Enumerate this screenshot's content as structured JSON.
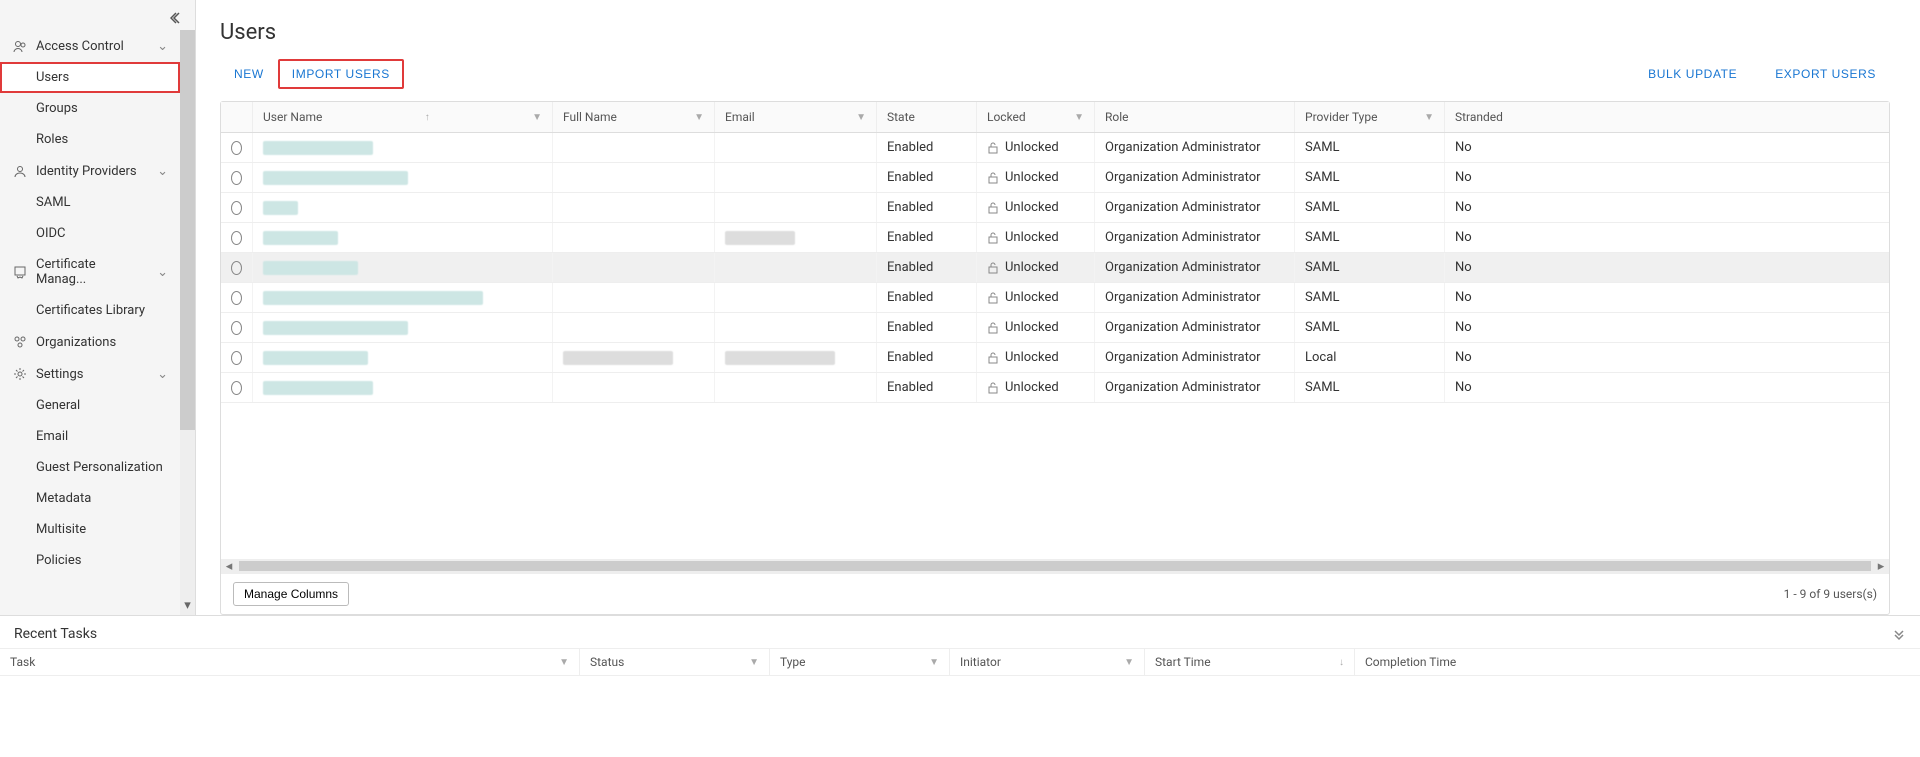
{
  "page": {
    "title": "Users"
  },
  "sidebar": {
    "groups": {
      "access_control": {
        "label": "Access Control"
      },
      "identity_providers": {
        "label": "Identity Providers"
      },
      "certificate_mgmt": {
        "label": "Certificate Manag..."
      },
      "organizations": {
        "label": "Organizations"
      },
      "settings": {
        "label": "Settings"
      }
    },
    "items": {
      "users": "Users",
      "groups": "Groups",
      "roles": "Roles",
      "saml": "SAML",
      "oidc": "OIDC",
      "cert_library": "Certificates Library",
      "general": "General",
      "email": "Email",
      "guest_personalization": "Guest Personalization",
      "metadata": "Metadata",
      "multisite": "Multisite",
      "policies": "Policies"
    }
  },
  "toolbar": {
    "new": "NEW",
    "import": "IMPORT USERS",
    "bulk_update": "BULK UPDATE",
    "export": "EXPORT USERS"
  },
  "grid": {
    "columns": {
      "user_name": "User Name",
      "full_name": "Full Name",
      "email": "Email",
      "state": "State",
      "locked": "Locked",
      "role": "Role",
      "provider_type": "Provider Type",
      "stranded": "Stranded"
    },
    "rows": [
      {
        "state": "Enabled",
        "locked": "Unlocked",
        "role": "Organization Administrator",
        "provider": "SAML",
        "stranded": "No"
      },
      {
        "state": "Enabled",
        "locked": "Unlocked",
        "role": "Organization Administrator",
        "provider": "SAML",
        "stranded": "No"
      },
      {
        "state": "Enabled",
        "locked": "Unlocked",
        "role": "Organization Administrator",
        "provider": "SAML",
        "stranded": "No"
      },
      {
        "state": "Enabled",
        "locked": "Unlocked",
        "role": "Organization Administrator",
        "provider": "SAML",
        "stranded": "No"
      },
      {
        "state": "Enabled",
        "locked": "Unlocked",
        "role": "Organization Administrator",
        "provider": "SAML",
        "stranded": "No"
      },
      {
        "state": "Enabled",
        "locked": "Unlocked",
        "role": "Organization Administrator",
        "provider": "SAML",
        "stranded": "No"
      },
      {
        "state": "Enabled",
        "locked": "Unlocked",
        "role": "Organization Administrator",
        "provider": "SAML",
        "stranded": "No"
      },
      {
        "state": "Enabled",
        "locked": "Unlocked",
        "role": "Organization Administrator",
        "provider": "Local",
        "stranded": "No"
      },
      {
        "state": "Enabled",
        "locked": "Unlocked",
        "role": "Organization Administrator",
        "provider": "SAML",
        "stranded": "No"
      }
    ],
    "footer": {
      "manage_columns": "Manage Columns",
      "page_info": "1 - 9 of 9 users(s)"
    }
  },
  "tasks": {
    "title": "Recent Tasks",
    "columns": {
      "task": "Task",
      "status": "Status",
      "type": "Type",
      "initiator": "Initiator",
      "start_time": "Start Time",
      "completion_time": "Completion Time"
    }
  }
}
